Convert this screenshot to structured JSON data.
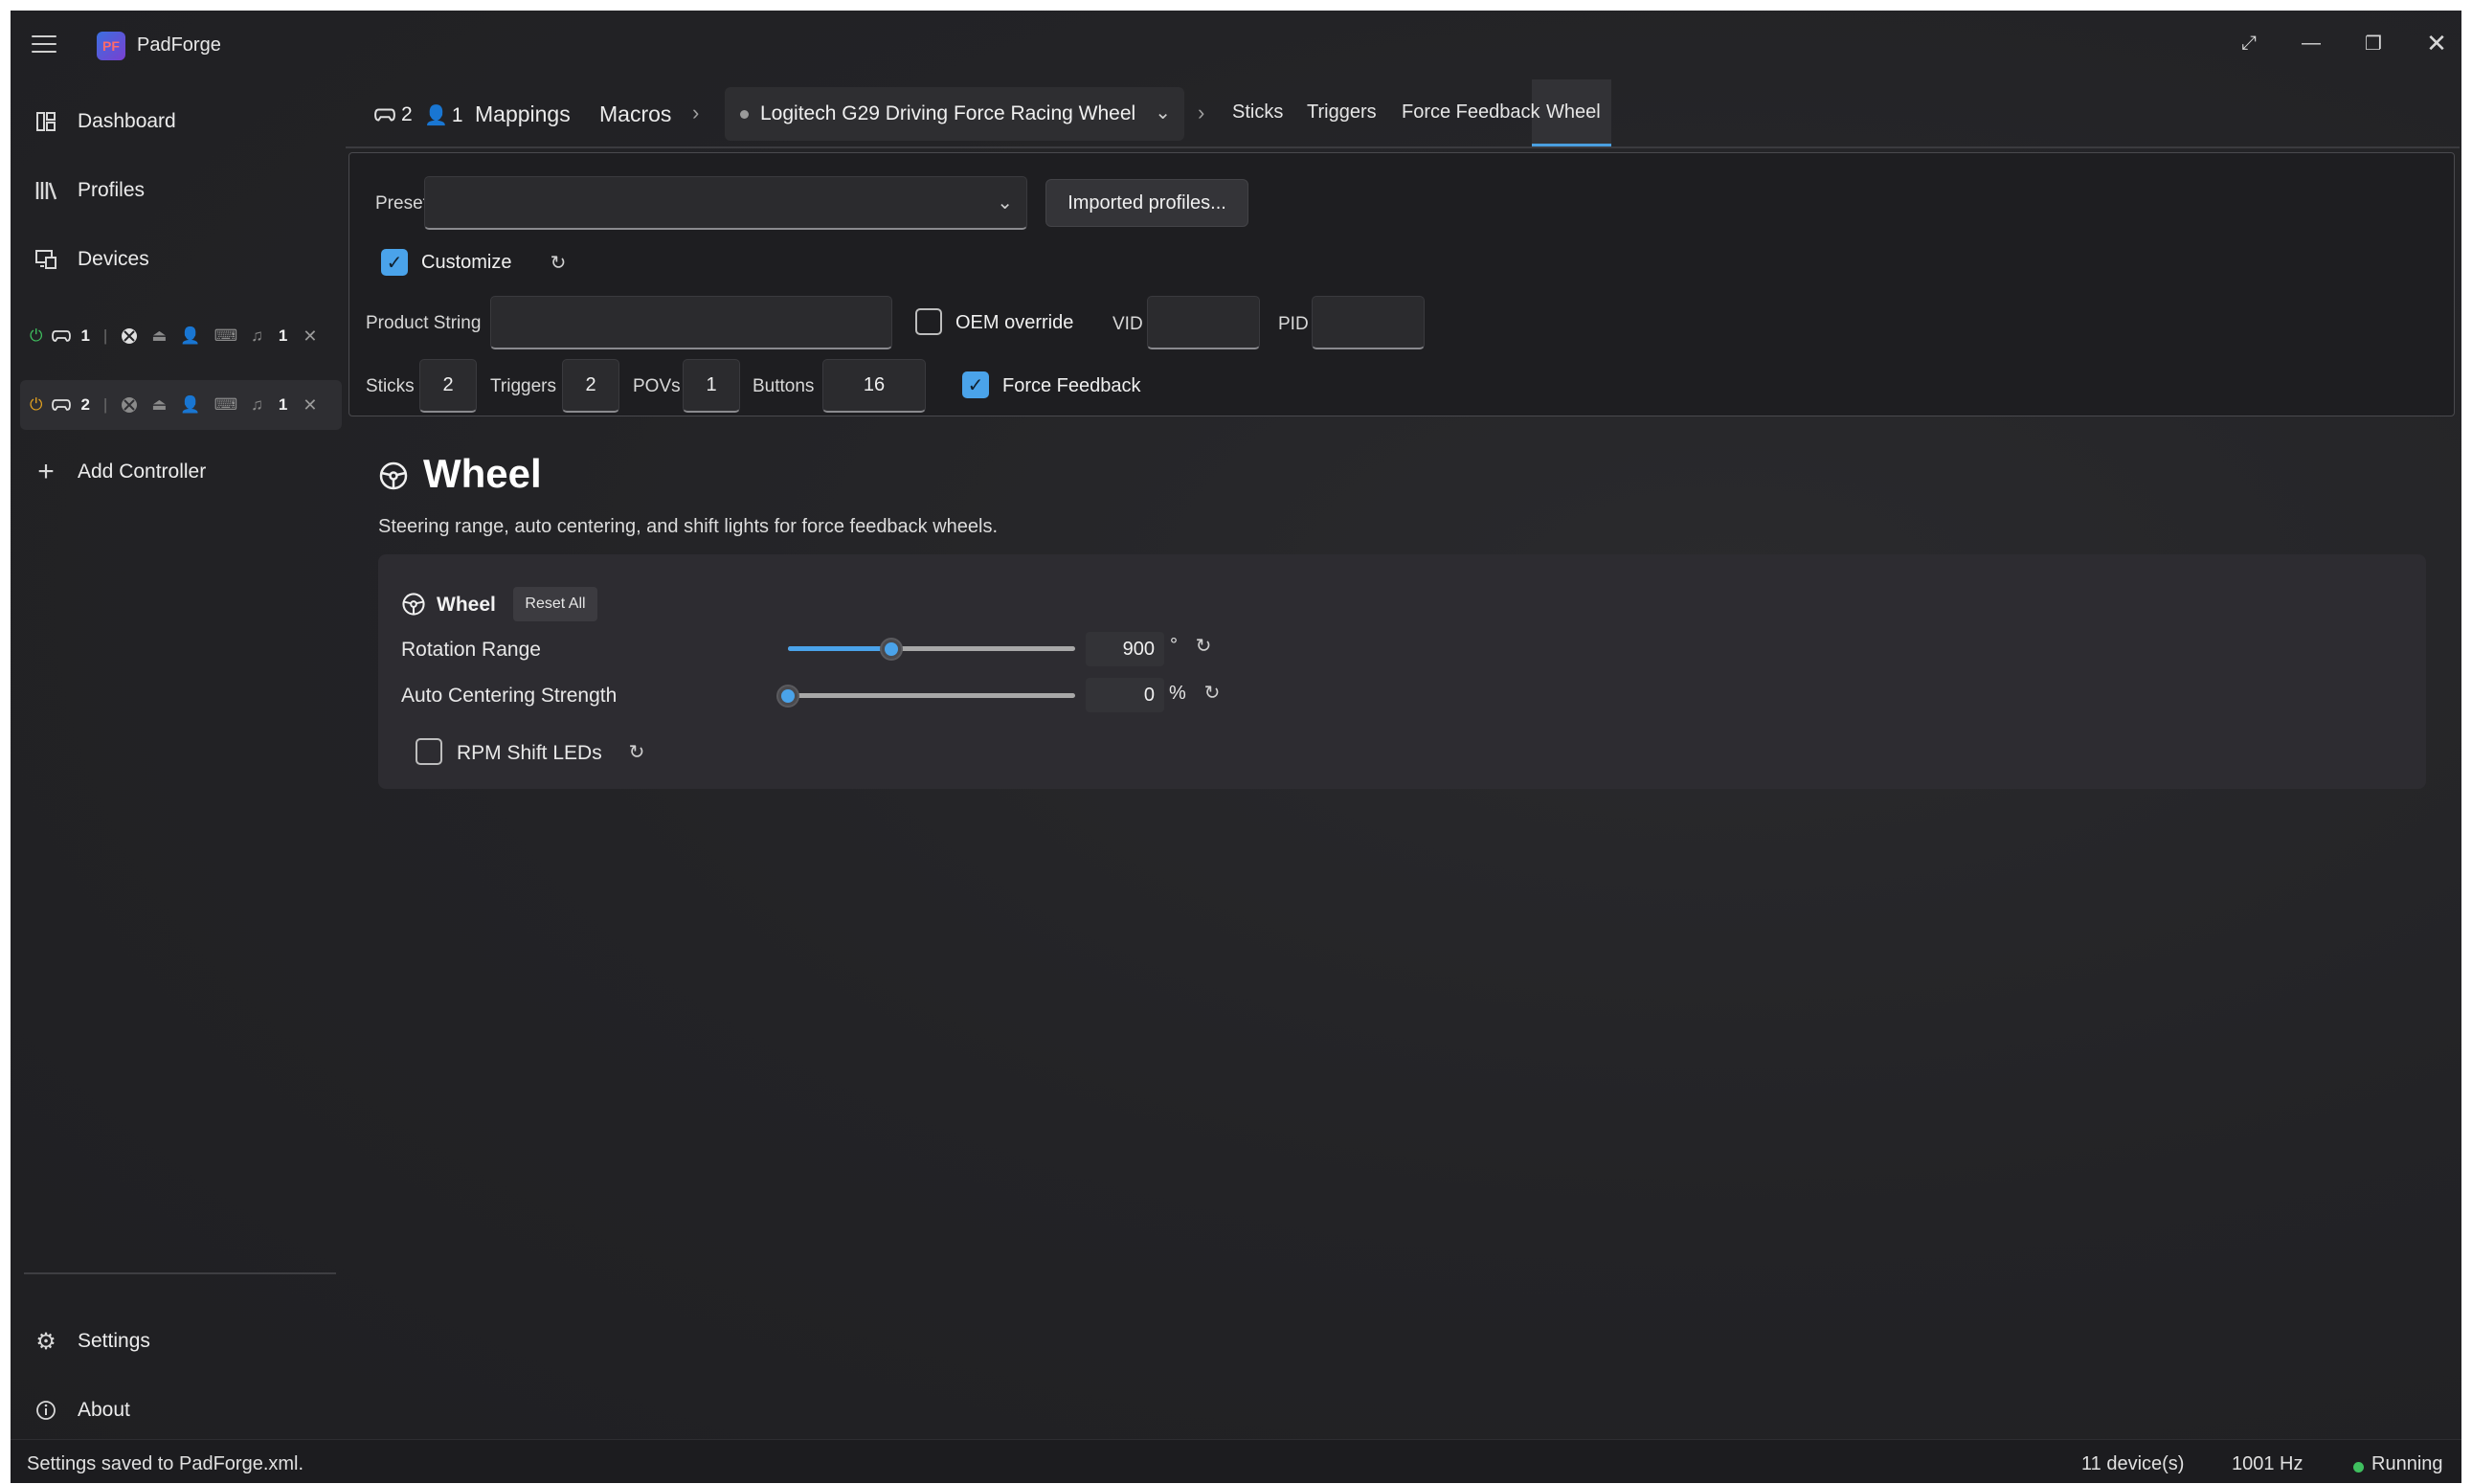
{
  "app": {
    "title": "PadForge",
    "logo_text": "PF"
  },
  "window_controls": [
    "expand-icon",
    "minimize-icon",
    "restore-icon",
    "close-icon"
  ],
  "sidebar": {
    "items": [
      {
        "label": "Dashboard",
        "icon": "dashboard-icon"
      },
      {
        "label": "Profiles",
        "icon": "library-icon"
      },
      {
        "label": "Devices",
        "icon": "devices-icon"
      }
    ],
    "slots": [
      {
        "number": "1",
        "count": "1",
        "active": false
      },
      {
        "number": "2",
        "count": "1",
        "active": true
      }
    ],
    "add_controller": "Add Controller",
    "settings": "Settings",
    "about": "About"
  },
  "navbar": {
    "controllers_count": "2",
    "users_count": "1",
    "links": [
      "Mappings",
      "Macros"
    ],
    "device": "Logitech G29 Driving Force Racing Wheel",
    "subtabs": [
      "Sticks",
      "Triggers",
      "Force Feedback",
      "Wheel"
    ],
    "active_subtab": "Wheel"
  },
  "config": {
    "preset_label": "Preset",
    "preset_value": "",
    "imported_profiles": "Imported profiles...",
    "customize_label": "Customize",
    "customize_checked": true,
    "product_string_label": "Product String",
    "product_string_value": "",
    "oem_override_label": "OEM override",
    "oem_override_checked": false,
    "vid_label": "VID",
    "vid_value": "",
    "pid_label": "PID",
    "pid_value": "",
    "sticks_label": "Sticks",
    "sticks_value": "2",
    "triggers_label": "Triggers",
    "triggers_value": "2",
    "povs_label": "POVs",
    "povs_value": "1",
    "buttons_label": "Buttons",
    "buttons_value": "16",
    "force_feedback_label": "Force Feedback",
    "force_feedback_checked": true
  },
  "page": {
    "title": "Wheel",
    "subtitle": "Steering range, auto centering, and shift lights for force feedback wheels."
  },
  "wheel_card": {
    "title": "Wheel",
    "reset_all": "Reset All",
    "rotation_range": {
      "label": "Rotation Range",
      "value": "900",
      "unit": "°",
      "slider_fraction": 0.36
    },
    "auto_centering": {
      "label": "Auto Centering Strength",
      "value": "0",
      "unit": "%",
      "slider_fraction": 0.0
    },
    "rpm_shift_leds": {
      "label": "RPM Shift LEDs",
      "checked": false
    }
  },
  "status": {
    "message": "Settings saved to PadForge.xml.",
    "devices": "11 device(s)",
    "rate": "1001 Hz",
    "state": "Running"
  },
  "colors": {
    "accent": "#4aa3ea",
    "running": "#3fbf5f",
    "power_green": "#3fbf5f",
    "power_yellow": "#e0a020"
  }
}
